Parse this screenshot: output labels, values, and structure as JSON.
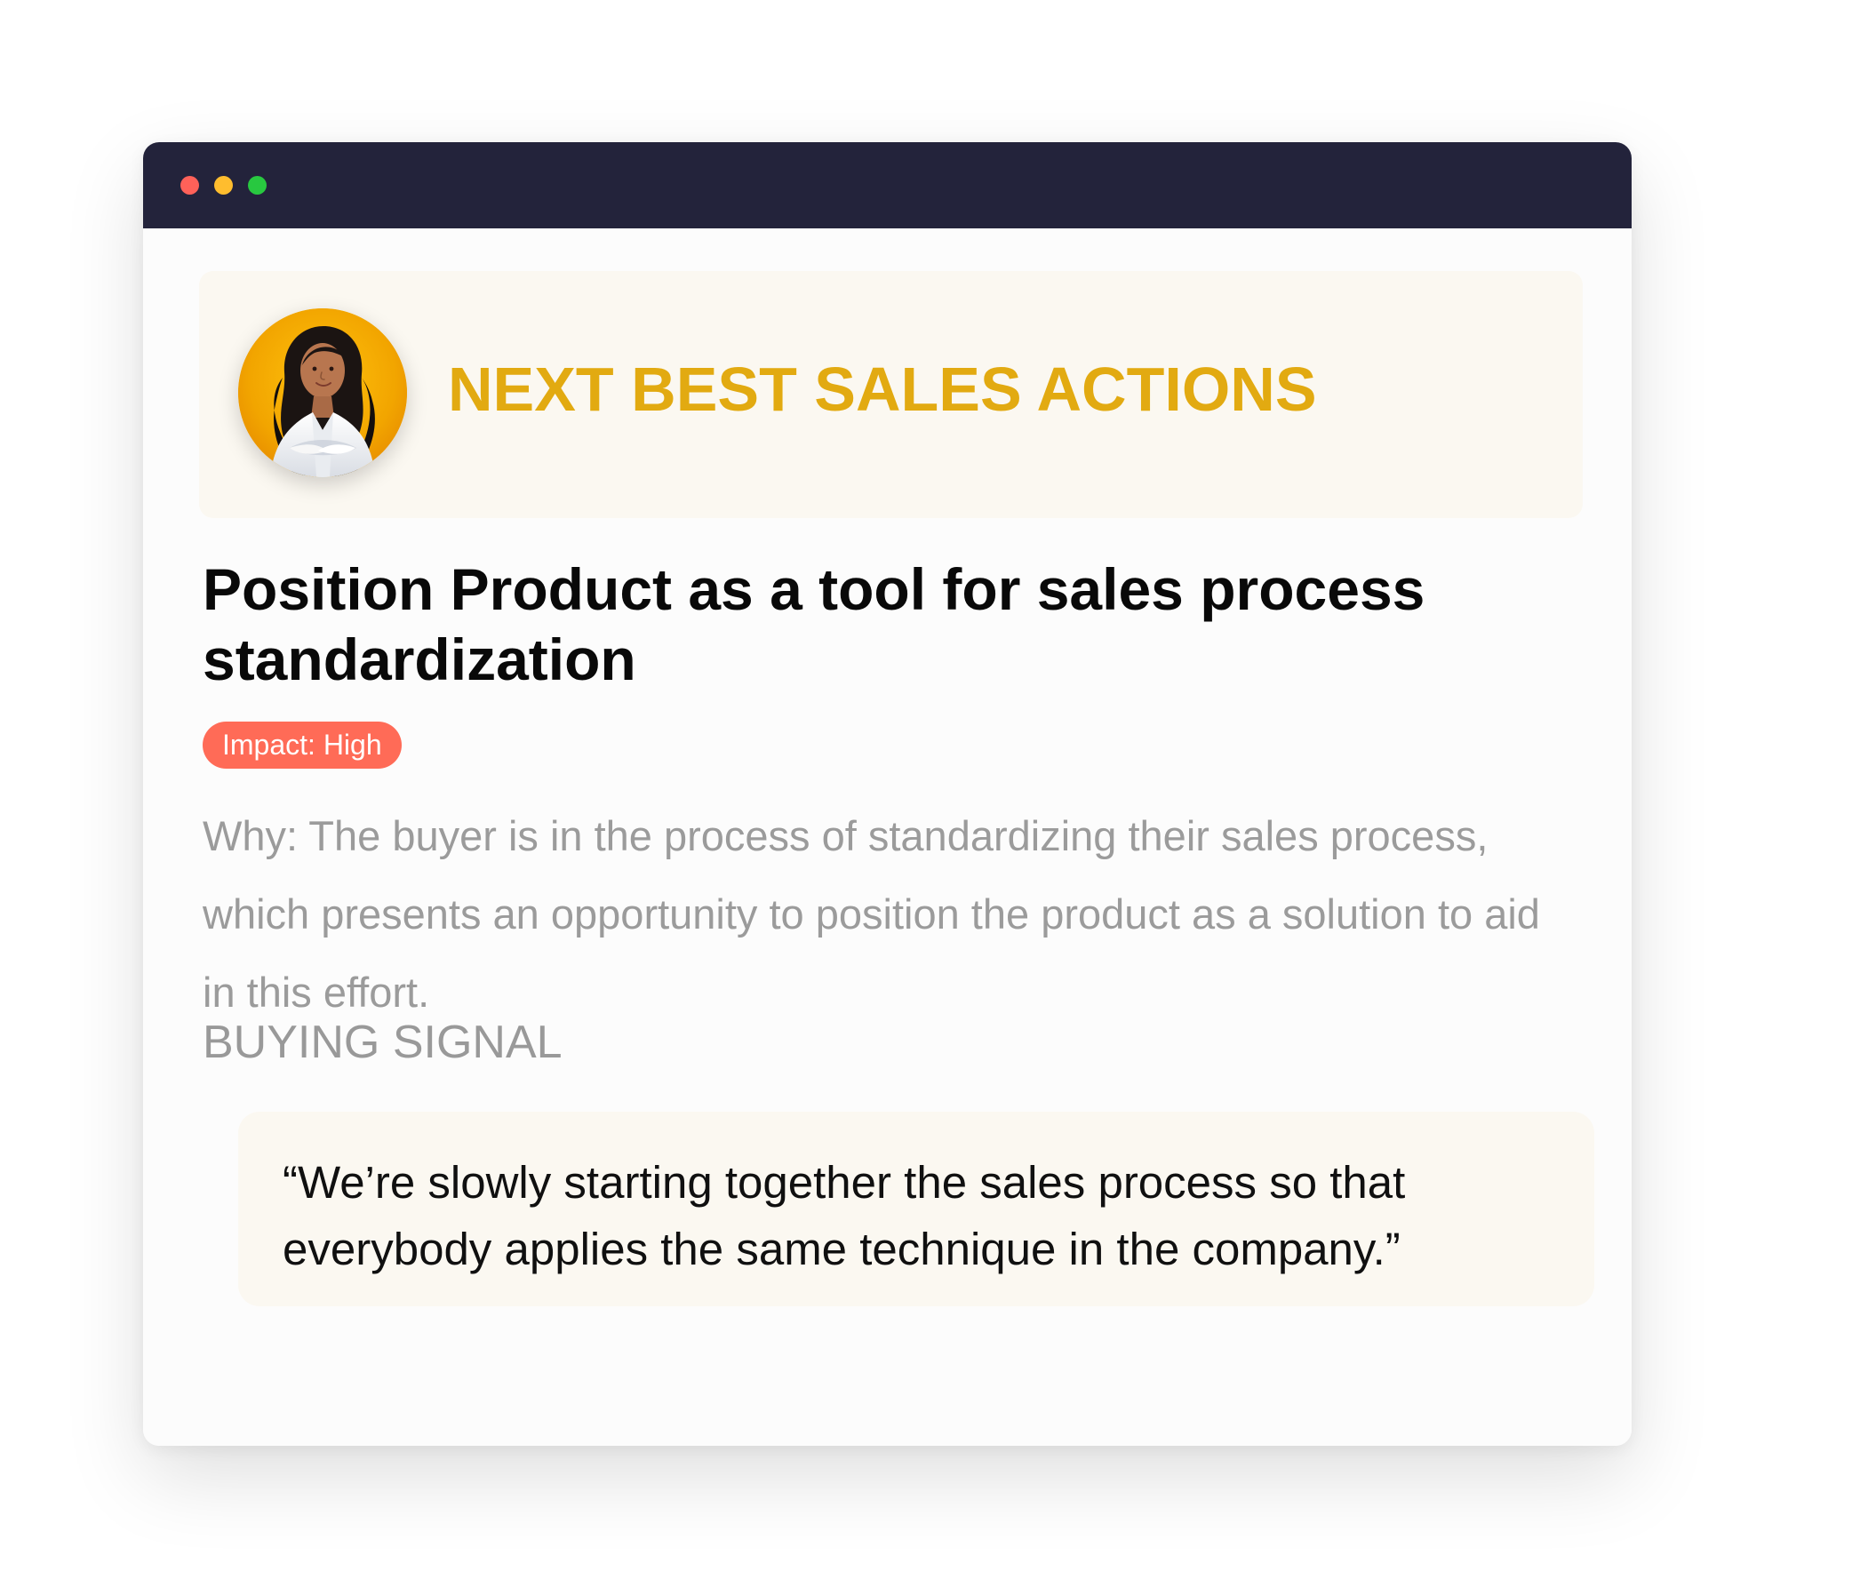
{
  "header": {
    "title": "NEXT BEST SALES ACTIONS"
  },
  "action": {
    "title": "Position Product as a tool for sales process standardization",
    "impact_badge": "Impact: High",
    "reason": "Why: The buyer is in the process of standardizing their sales process, which presents an opportunity to position the product as a solution to aid in this effort."
  },
  "buying_signal": {
    "label": "BUYING SIGNAL",
    "quote": "“We’re slowly starting together the sales process so that everybody applies the same technique in the company.”"
  },
  "icons": {
    "window_controls": [
      "close-icon",
      "minimize-icon",
      "zoom-icon"
    ],
    "avatar": "profile-photo"
  },
  "colors": {
    "titlebar": "#23233b",
    "accent_gold": "#e2aa11",
    "impact_high": "#ff6b57",
    "highlight_background": "#fbf8f1"
  }
}
